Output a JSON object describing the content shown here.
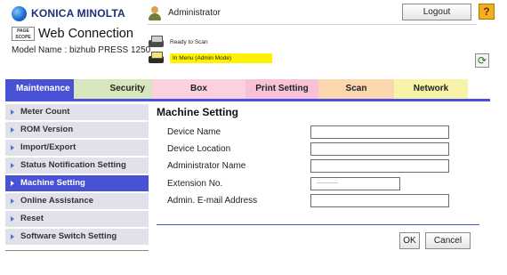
{
  "header": {
    "brand": "KONICA MINOLTA",
    "pagescope_logo": "PAGE SCOPE",
    "app_title": "Web Connection",
    "model_label": "Model Name : bizhub PRESS 1250",
    "user": "Administrator",
    "status_ready": "Ready to Scan",
    "status_menu": "In Menu (Admin Mode)",
    "logout_label": "Logout",
    "help_glyph": "?",
    "refresh_glyph": "⟳",
    "status_highlight_color": "#fff200"
  },
  "tabs": [
    {
      "label": "Maintenance",
      "active": true
    },
    {
      "label": "Security"
    },
    {
      "label": "Box"
    },
    {
      "label": "Print Setting"
    },
    {
      "label": "Scan"
    },
    {
      "label": "Network"
    }
  ],
  "sidebar": {
    "items": [
      {
        "label": "Meter Count"
      },
      {
        "label": "ROM Version"
      },
      {
        "label": "Import/Export"
      },
      {
        "label": "Status Notification Setting"
      },
      {
        "label": "Machine Setting",
        "active": true
      },
      {
        "label": "Online Assistance"
      },
      {
        "label": "Reset"
      },
      {
        "label": "Software Switch Setting"
      }
    ]
  },
  "main": {
    "title": "Machine Setting",
    "fields": [
      {
        "label": "Device Name",
        "value": ""
      },
      {
        "label": "Device Location",
        "value": ""
      },
      {
        "label": "Administrator Name",
        "value": ""
      },
      {
        "label": "Extension No.",
        "value": ""
      },
      {
        "label": "Admin. E-mail Address",
        "value": ""
      }
    ],
    "ok_label": "OK",
    "cancel_label": "Cancel"
  },
  "colors": {
    "accent": "#4852d4",
    "security_tab": "#d8e6bd",
    "box_tab": "#fbd1de",
    "print_tab": "#f7c2d8",
    "scan_tab": "#fcd6ad",
    "network_tab": "#f7f3a8",
    "menu_bg": "#e1e1ec"
  }
}
